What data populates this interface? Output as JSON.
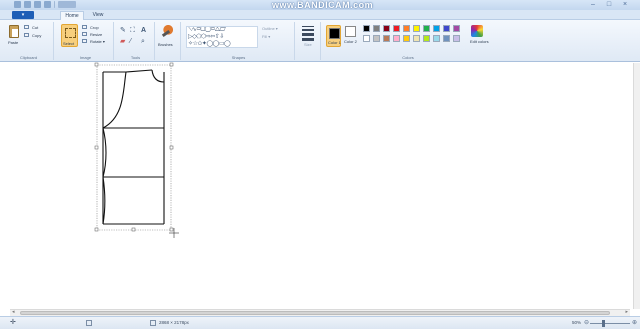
{
  "watermark": "www.BANDICAM.com",
  "window_controls": {
    "minimize": "–",
    "maximize": "□",
    "close": "×"
  },
  "tabs": {
    "file": "▾",
    "home": "Home",
    "view": "View"
  },
  "clipboard": {
    "paste": "Paste",
    "cut": "Cut",
    "copy": "Copy",
    "label": "Clipboard"
  },
  "image": {
    "select": "Select",
    "crop": "Crop",
    "resize": "Resize",
    "rotate": "Rotate ▾",
    "label": "Image"
  },
  "tools": {
    "label": "Tools",
    "text_glyph": "A"
  },
  "brushes": {
    "label": "Brushes"
  },
  "shapes": {
    "row1": "⟍∿▭▢◯▭△▱",
    "row2": "▷◇⬠⬡⇨⇦⇧⇩",
    "row3": "✧☆✩✦◯◯▭◯",
    "outline": "Outline ▾",
    "fill": "Fill ▾",
    "label": "Shapes"
  },
  "size": {
    "label": "Size"
  },
  "colors": {
    "color1": "Color 1",
    "color2": "Color 2",
    "edit": "Edit colors",
    "label": "Colors",
    "palette_row1": [
      "#000000",
      "#7f7f7f",
      "#880015",
      "#ed1c24",
      "#ff7f27",
      "#fff200",
      "#22b14c",
      "#00a2e8",
      "#3f48cc",
      "#a349a4"
    ],
    "palette_row2": [
      "#ffffff",
      "#c3c3c3",
      "#b97a57",
      "#ffaec9",
      "#ffc90e",
      "#efe4b0",
      "#b5e61d",
      "#99d9ea",
      "#7092be",
      "#c8bfe7"
    ]
  },
  "statusbar": {
    "canvas_size": "2868 × 2178px",
    "zoom": "50%",
    "zoom_out": "⊖",
    "zoom_in": "⊕"
  },
  "scroll": {
    "left": "◂",
    "right": "▸"
  }
}
